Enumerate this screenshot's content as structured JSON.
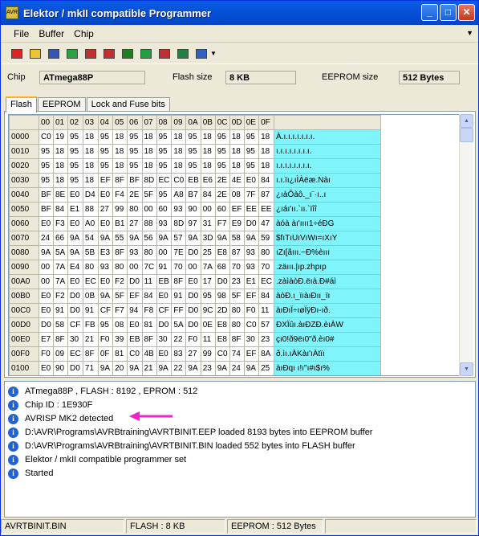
{
  "window": {
    "title": "Elektor / mkII compatible Programmer",
    "icon_text": "AVR"
  },
  "titlebar_buttons": {
    "minimize": "_",
    "maximize": "□",
    "close": "✕"
  },
  "menu": [
    "File",
    "Buffer",
    "Chip"
  ],
  "toolbar": {
    "icons": [
      "eraser-icon",
      "open-folder-icon",
      "save-disk-icon",
      "read-chip-icon",
      "write-chip-icon",
      "read-flash-icon",
      "write-flash-icon",
      "verify-icon",
      "chip-program-icon",
      "book-icon",
      "settings-icon"
    ],
    "colors": [
      "#d22",
      "#f2c230",
      "#3554b8",
      "#2aa040",
      "#c03030",
      "#c03030",
      "#208020",
      "#20a040",
      "#c03030",
      "#208040",
      "#3060c0"
    ]
  },
  "chip": {
    "chip_label": "Chip",
    "chip_value": "ATmega88P",
    "flash_label": "Flash size",
    "flash_value": "8 KB",
    "eeprom_label": "EEPROM size",
    "eeprom_value": "512 Bytes"
  },
  "tabs": [
    "Flash",
    "EEPROM",
    "Lock and Fuse bits"
  ],
  "hex": {
    "columns": [
      "00",
      "01",
      "02",
      "03",
      "04",
      "05",
      "06",
      "07",
      "08",
      "09",
      "0A",
      "0B",
      "0C",
      "0D",
      "0E",
      "0F"
    ],
    "rows": [
      {
        "addr": "0000",
        "bytes": [
          "C0",
          "19",
          "95",
          "18",
          "95",
          "18",
          "95",
          "18",
          "95",
          "18",
          "95",
          "18",
          "95",
          "18",
          "95",
          "18"
        ],
        "ascii": "À.ı.ı.ı.ı.ı.ı.ı."
      },
      {
        "addr": "0010",
        "bytes": [
          "95",
          "18",
          "95",
          "18",
          "95",
          "18",
          "95",
          "18",
          "95",
          "18",
          "95",
          "18",
          "95",
          "18",
          "95",
          "18"
        ],
        "ascii": "ı.ı.ı.ı.ı.ı.ı.ı."
      },
      {
        "addr": "0020",
        "bytes": [
          "95",
          "18",
          "95",
          "18",
          "95",
          "18",
          "95",
          "18",
          "95",
          "18",
          "95",
          "18",
          "95",
          "18",
          "95",
          "18"
        ],
        "ascii": "ı.ı.ı.ı.ı.ı.ı.ı."
      },
      {
        "addr": "0030",
        "bytes": [
          "95",
          "18",
          "95",
          "18",
          "EF",
          "8F",
          "BF",
          "8D",
          "EC",
          "C0",
          "EB",
          "E6",
          "2E",
          "4E",
          "E0",
          "84"
        ],
        "ascii": "ı.ı.ïı¿ıÌÀëæ.Nàı"
      },
      {
        "addr": "0040",
        "bytes": [
          "BF",
          "8E",
          "E0",
          "D4",
          "E0",
          "F4",
          "2E",
          "5F",
          "95",
          "A8",
          "B7",
          "84",
          "2E",
          "08",
          "7F",
          "87"
        ],
        "ascii": "¿ıàÔàô._ı¨·ı..ı"
      },
      {
        "addr": "0050",
        "bytes": [
          "BF",
          "84",
          "E1",
          "88",
          "27",
          "99",
          "80",
          "00",
          "60",
          "93",
          "90",
          "00",
          "60",
          "EF",
          "EE",
          "EE"
        ],
        "ascii": "¿ıáı'ıı.`ıı.`ïîî"
      },
      {
        "addr": "0060",
        "bytes": [
          "E0",
          "F3",
          "E0",
          "A0",
          "E0",
          "B1",
          "27",
          "88",
          "93",
          "8D",
          "97",
          "31",
          "F7",
          "E9",
          "D0",
          "47"
        ],
        "ascii": "àóà àı'ıııı1÷éÐG"
      },
      {
        "addr": "0070",
        "bytes": [
          "24",
          "66",
          "9A",
          "54",
          "9A",
          "55",
          "9A",
          "56",
          "9A",
          "57",
          "9A",
          "3D",
          "9A",
          "58",
          "9A",
          "59"
        ],
        "ascii": "$fıTıUıVıWı=ıXıY"
      },
      {
        "addr": "0080",
        "bytes": [
          "9A",
          "5A",
          "9A",
          "5B",
          "E3",
          "8F",
          "93",
          "80",
          "00",
          "7E",
          "D0",
          "25",
          "E8",
          "87",
          "93",
          "80"
        ],
        "ascii": "ıZı[ãııı.~Ð%èııı"
      },
      {
        "addr": "0090",
        "bytes": [
          "00",
          "7A",
          "E4",
          "80",
          "93",
          "80",
          "00",
          "7C",
          "91",
          "70",
          "00",
          "7A",
          "68",
          "70",
          "93",
          "70"
        ],
        "ascii": ".zäııı.|ıp.zhpıp"
      },
      {
        "addr": "00A0",
        "bytes": [
          "00",
          "7A",
          "E0",
          "EC",
          "E0",
          "F2",
          "D0",
          "11",
          "EB",
          "8F",
          "E0",
          "17",
          "D0",
          "23",
          "E1",
          "EC"
        ],
        "ascii": ".zàìàòÐ.ëıà.Ð#áì"
      },
      {
        "addr": "00B0",
        "bytes": [
          "E0",
          "F2",
          "D0",
          "0B",
          "9A",
          "5F",
          "EF",
          "84",
          "E0",
          "91",
          "D0",
          "95",
          "98",
          "5F",
          "EF",
          "84"
        ],
        "ascii": "àòÐ.ı_ïıàıÐıı_ïı"
      },
      {
        "addr": "00C0",
        "bytes": [
          "E0",
          "91",
          "D0",
          "91",
          "CF",
          "F7",
          "94",
          "F8",
          "CF",
          "FF",
          "D0",
          "9C",
          "2D",
          "80",
          "F0",
          "11"
        ],
        "ascii": "àıÐıÏ÷ıøÏÿÐı-ıð."
      },
      {
        "addr": "00D0",
        "bytes": [
          "D0",
          "58",
          "CF",
          "FB",
          "95",
          "08",
          "E0",
          "81",
          "D0",
          "5A",
          "D0",
          "0E",
          "E8",
          "80",
          "C0",
          "57"
        ],
        "ascii": "ÐXÏûı.àıÐZÐ.èıÀW"
      },
      {
        "addr": "00E0",
        "bytes": [
          "E7",
          "8F",
          "30",
          "21",
          "F0",
          "39",
          "EB",
          "8F",
          "30",
          "22",
          "F0",
          "11",
          "E8",
          "8F",
          "30",
          "23"
        ],
        "ascii": "çı0!ð9ëı0\"ð.èı0#"
      },
      {
        "addr": "00F0",
        "bytes": [
          "F0",
          "09",
          "EC",
          "8F",
          "0F",
          "81",
          "C0",
          "4B",
          "E0",
          "83",
          "27",
          "99",
          "C0",
          "74",
          "EF",
          "8A"
        ],
        "ascii": "ð.ìı.ıÀKàı'ıÀtïı"
      },
      {
        "addr": "0100",
        "bytes": [
          "E0",
          "90",
          "D0",
          "71",
          "9A",
          "20",
          "9A",
          "21",
          "9A",
          "22",
          "9A",
          "23",
          "9A",
          "24",
          "9A",
          "25"
        ],
        "ascii": "àıÐqı ı!ı\"ı#ı$ı%"
      }
    ]
  },
  "log": [
    "ATmega88P , FLASH : 8192 , EPROM : 512",
    "Chip ID : 1E930F",
    "AVRISP MK2 detected",
    "D:\\AVR\\Programs\\AVRBtraining\\AVRTBINIT.EEP loaded 8193 bytes into EEPROM buffer",
    "D:\\AVR\\Programs\\AVRBtraining\\AVRTBINIT.BIN loaded 552 bytes into FLASH buffer",
    "Elektor / mkII compatible programmer set",
    "Started"
  ],
  "status": {
    "file": "AVRTBINIT.BIN",
    "flash": "FLASH : 8 KB",
    "eeprom": "EEPROM : 512 Bytes"
  },
  "scrollbar": {
    "up": "▲",
    "down": "▼"
  },
  "colors": {
    "ascii_bg": "#7ff4fb",
    "arrow": "#ee22cc",
    "info": "#1f63d6"
  }
}
